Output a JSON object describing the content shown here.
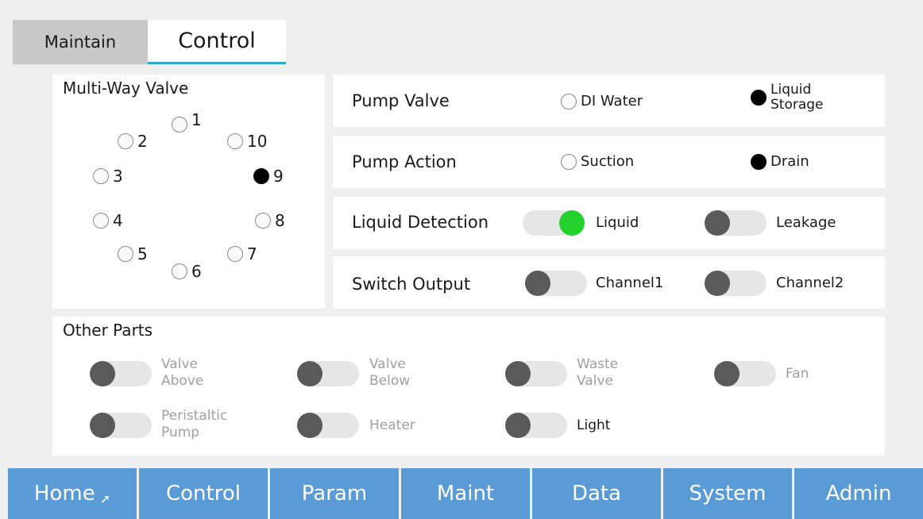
{
  "tabs": {
    "maintain": "Maintain",
    "control": "Control"
  },
  "multi_way_valve": {
    "title": "Multi-Way Valve",
    "selected": "9",
    "options": [
      "1",
      "2",
      "3",
      "4",
      "5",
      "6",
      "7",
      "8",
      "9",
      "10"
    ]
  },
  "pump_valve": {
    "label": "Pump Valve",
    "opt1": "DI Water",
    "opt2_line1": "Liquid",
    "opt2_line2": "Storage",
    "selected": "Liquid Storage"
  },
  "pump_action": {
    "label": "Pump Action",
    "opt1": "Suction",
    "opt2": "Drain",
    "selected": "Drain"
  },
  "liquid_detection": {
    "label": "Liquid Detection",
    "liquid": "Liquid",
    "leakage": "Leakage",
    "liquid_on": true,
    "leakage_on": false
  },
  "switch_output": {
    "label": "Switch Output",
    "channel1": "Channel1",
    "channel2": "Channel2",
    "channel1_on": false,
    "channel2_on": false
  },
  "other_parts": {
    "title": "Other Parts",
    "valve_above_1": "Valve",
    "valve_above_2": "Above",
    "valve_below_1": "Valve",
    "valve_below_2": "Below",
    "waste_valve_1": "Waste",
    "waste_valve_2": "Valve",
    "fan": "Fan",
    "peristaltic_1": "Peristaltic",
    "peristaltic_2": "Pump",
    "heater": "Heater",
    "light": "Light"
  },
  "nav": [
    "Home",
    "Control",
    "Param",
    "Maint",
    "Data",
    "System",
    "Admin"
  ],
  "colors": {
    "nav_bg": "#5b9bd5",
    "tab_underline": "#2aa7c9",
    "toggle_on": "#22d12b",
    "knob_off": "#5a5a5a"
  },
  "icons": {
    "cursor": "mouse-pointer-icon"
  }
}
